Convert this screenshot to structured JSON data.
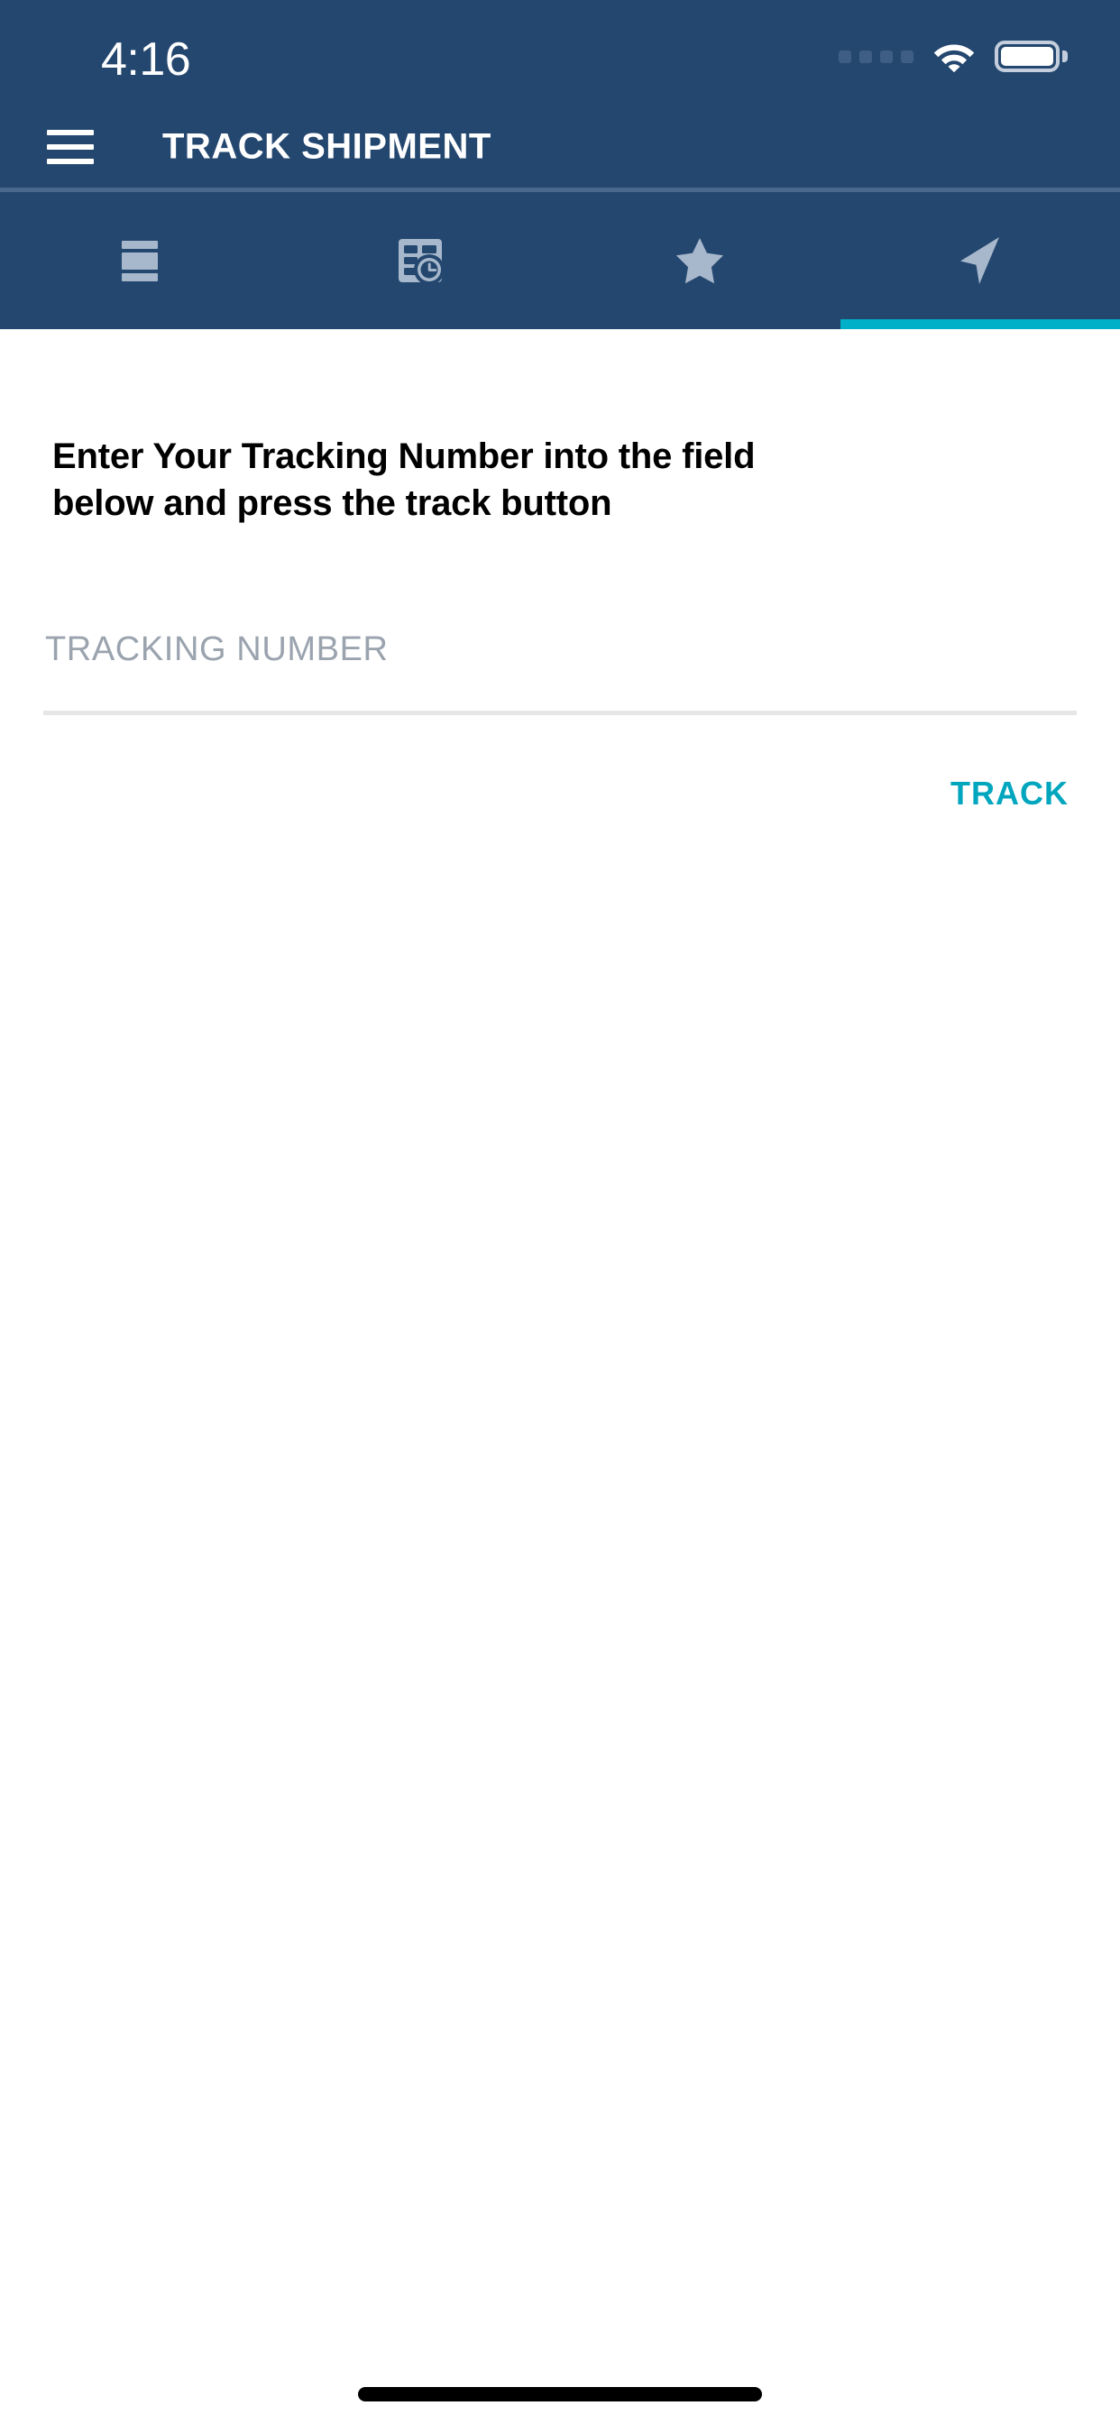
{
  "status_bar": {
    "time": "4:16",
    "signal_icon": "signal-dots-icon",
    "wifi_icon": "wifi-icon",
    "battery_icon": "battery-full-icon"
  },
  "app_bar": {
    "menu_icon": "hamburger-menu-icon",
    "title": "TRACK SHIPMENT"
  },
  "tabs": [
    {
      "id": "shipments",
      "icon": "list-layout-icon",
      "label": "",
      "active": false
    },
    {
      "id": "pending",
      "icon": "table-clock-icon",
      "label": "",
      "active": false
    },
    {
      "id": "favorites",
      "icon": "star-icon",
      "label": "",
      "active": false
    },
    {
      "id": "track",
      "icon": "navigation-arrow-icon",
      "label": "",
      "active": true
    }
  ],
  "content": {
    "instruction": "Enter Your Tracking Number into the field below and press the track button",
    "tracking_field": {
      "label": "TRACKING NUMBER",
      "placeholder": "TRACKING NUMBER",
      "value": ""
    },
    "track_button": "TRACK"
  },
  "colors": {
    "header_blue": "#24476F",
    "accent_teal": "#00AFC8",
    "button_teal": "#00A6BE",
    "divider": "#4A688D",
    "underline": "#E6E6E8",
    "placeholder": "#9AA3AE"
  }
}
